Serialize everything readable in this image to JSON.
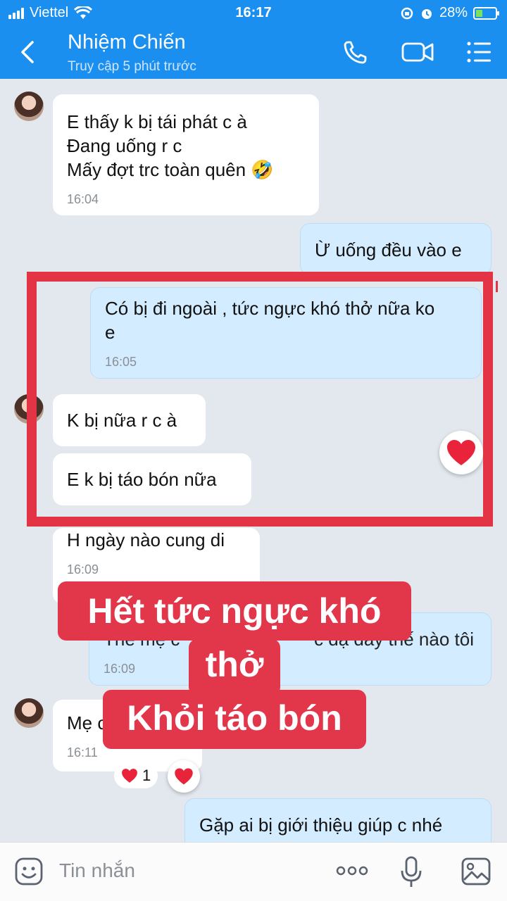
{
  "status_bar": {
    "carrier": "Viettel",
    "time": "16:17",
    "battery": "28%"
  },
  "header": {
    "contact_name": "Nhiệm Chiến",
    "last_seen": "Truy cập 5 phút trước",
    "back_icon": "chevron-left-icon",
    "call_icon": "phone-icon",
    "video_icon": "video-camera-icon",
    "menu_icon": "menu-list-icon"
  },
  "messages": [
    {
      "dir": "in",
      "lines": [
        "E thấy k bị tái phát c à",
        "Đang uống r c",
        "Mấy đợt trc toàn quên 🤣"
      ],
      "time": "16:04"
    },
    {
      "dir": "out",
      "lines": [
        "Ừ uống đều vào e"
      ]
    },
    {
      "dir": "out",
      "lines": [
        "Có bị đi ngoài , tức ngực khó thở nữa ko",
        "e"
      ],
      "time": "16:05"
    },
    {
      "dir": "in",
      "lines": [
        "K bị nữa r c à"
      ]
    },
    {
      "dir": "in",
      "lines": [
        "E k bị táo bón nữa"
      ]
    },
    {
      "dir": "in",
      "lines": [
        "H ngày nào cung di"
      ],
      "time": "16:09"
    },
    {
      "dir": "out",
      "lines": [
        "Thế mẹ c",
        "c dạ dày thế nào tôi"
      ],
      "time": "16:09"
    },
    {
      "dir": "in",
      "lines": [
        "Mẹ c"
      ],
      "time": "16:11",
      "reaction_count": "1"
    },
    {
      "dir": "out",
      "lines": [
        "Gặp ai bị giới thiệu giúp c nhé"
      ]
    }
  ],
  "overlay": {
    "line1": "Hết tức ngực khó",
    "line2": "thở",
    "line3": "Khỏi táo bón"
  },
  "composer": {
    "placeholder": "Tin nhắn",
    "sticker_icon": "sticker-face-icon",
    "more_icon": "more-dots-icon",
    "mic_icon": "microphone-icon",
    "image_icon": "image-icon"
  },
  "colors": {
    "brand_blue": "#1b8ff0",
    "outgoing_bubble": "#d4ecff",
    "incoming_bubble": "#ffffff",
    "highlight_red": "#e23445",
    "chat_background": "#e3e8ef"
  }
}
